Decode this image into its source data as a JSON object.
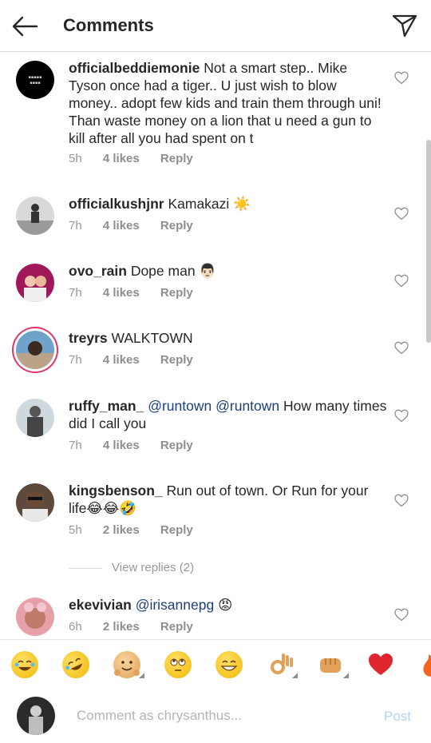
{
  "header": {
    "title": "Comments"
  },
  "comments": [
    {
      "username": "officialbeddiemonie",
      "text": " Not a smart step.. Mike Tyson once had a tiger.. U just wish to blow money.. adopt few kids and train them through uni! Than waste money on a lion that u need a gun to kill after all you had spent on t",
      "time": "5h",
      "likes": "4 likes",
      "reply": "Reply"
    },
    {
      "username": "officialkushjnr",
      "text": " Kamakazi ☀️",
      "time": "7h",
      "likes": "4 likes",
      "reply": "Reply"
    },
    {
      "username": "ovo_rain",
      "text": " Dope man 👨🏻",
      "time": "7h",
      "likes": "4 likes",
      "reply": "Reply"
    },
    {
      "username": "treyrs",
      "text": " WALKTOWN",
      "time": "7h",
      "likes": "4 likes",
      "reply": "Reply"
    },
    {
      "username": "ruffy_man_",
      "mention1": "@runtown",
      "mention2": "@runtown",
      "text": " How many times did I call you",
      "time": "7h",
      "likes": "4 likes",
      "reply": "Reply"
    },
    {
      "username": "kingsbenson_",
      "text": " Run out of town. Or Run for your life😂😂🤣",
      "time": "5h",
      "likes": "2 likes",
      "reply": "Reply"
    },
    {
      "username": "ekevivian",
      "mention1": "@irisannepg",
      "text": " 😡",
      "time": "6h",
      "likes": "2 likes",
      "reply": "Reply"
    }
  ],
  "view_replies": "View replies (2)",
  "emoji_bar": [
    "face-with-tears-of-joy",
    "rolling-laughing",
    "hugging-face",
    "rolling-eyes",
    "grinning-face",
    "ok-hand",
    "fist-bump",
    "red-heart",
    "fire"
  ],
  "composer": {
    "placeholder": "Comment as chrysanthus...",
    "post_label": "Post"
  },
  "colors": {
    "mention": "#1c3f7a",
    "post_disabled": "#b2d4f5",
    "story_ring": "#e0356b"
  }
}
